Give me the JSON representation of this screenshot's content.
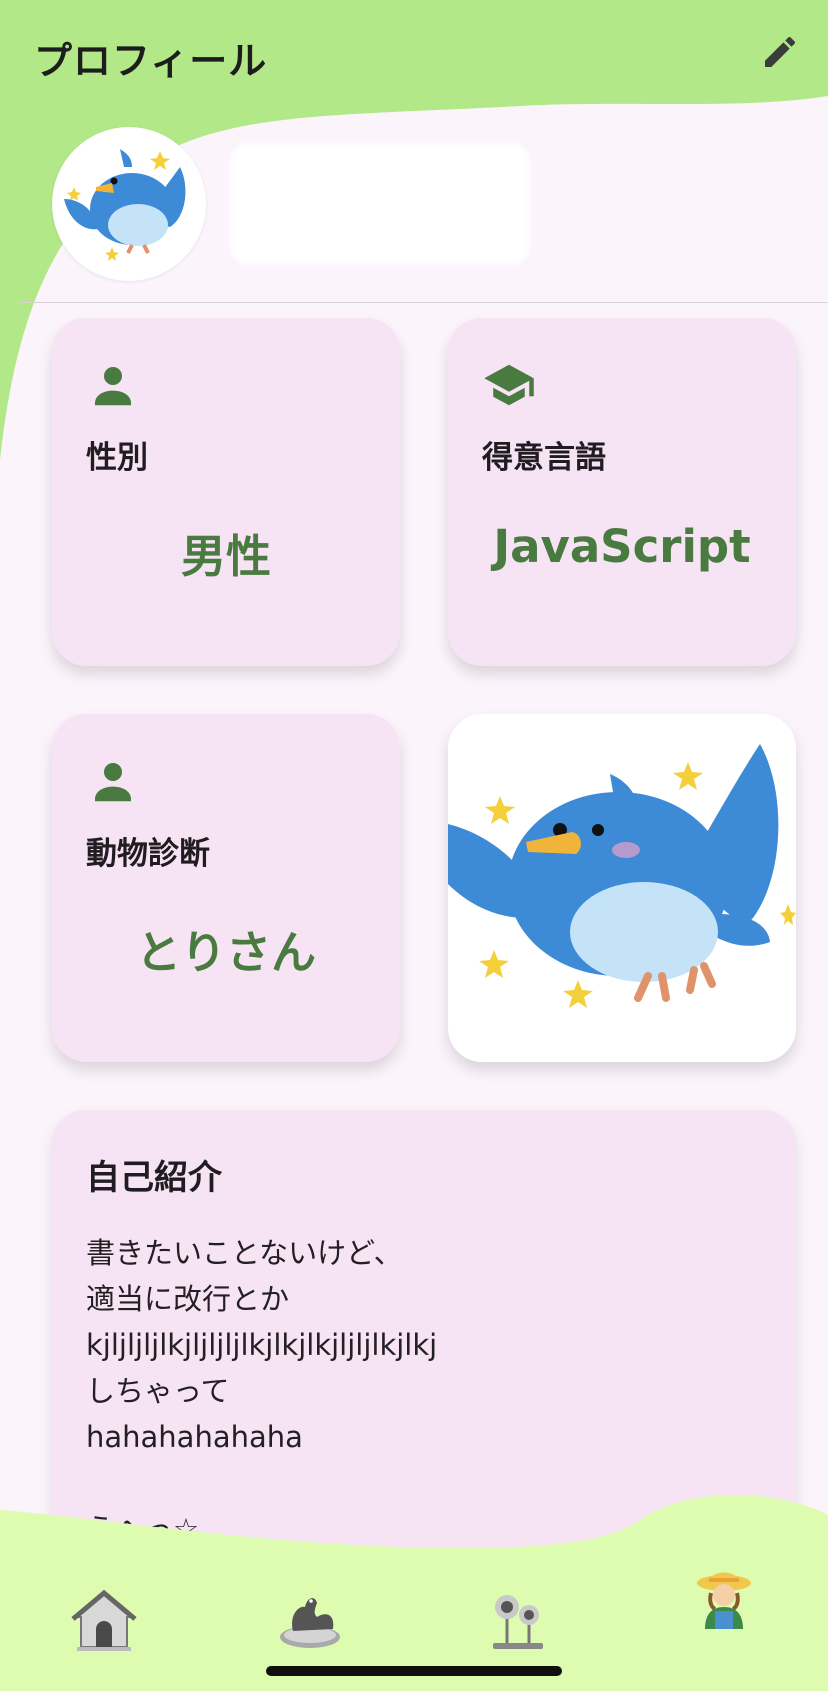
{
  "header": {
    "title": "プロフィール"
  },
  "profile": {
    "avatar_icon": "blue-bird-avatar",
    "name": ""
  },
  "cards": [
    {
      "icon": "person-icon",
      "label": "性別",
      "value": "男性"
    },
    {
      "icon": "graduation-cap-icon",
      "label": "得意言語",
      "value": "JavaScript"
    },
    {
      "icon": "person-icon",
      "label": "動物診断",
      "value": "とりさん"
    }
  ],
  "animal_image": "blue-bird-illustration",
  "intro": {
    "title": "自己紹介",
    "lines": [
      "書きたいことないけど、",
      "適当に改行とか",
      "kjljljljlkjljljljlkjlkjlkjljljlkjlkj",
      "しちゃって",
      "hahahahahaha",
      "",
      "うへっ☆"
    ]
  },
  "nav": [
    "house-icon",
    "hen-nest-icon",
    "sunflowers-icon",
    "farmer-icon"
  ],
  "colors": {
    "accent_green": "#b2e887",
    "value_green": "#497a3f",
    "card_pink": "#f6e3f3",
    "nav_green": "#ddfcb0"
  }
}
